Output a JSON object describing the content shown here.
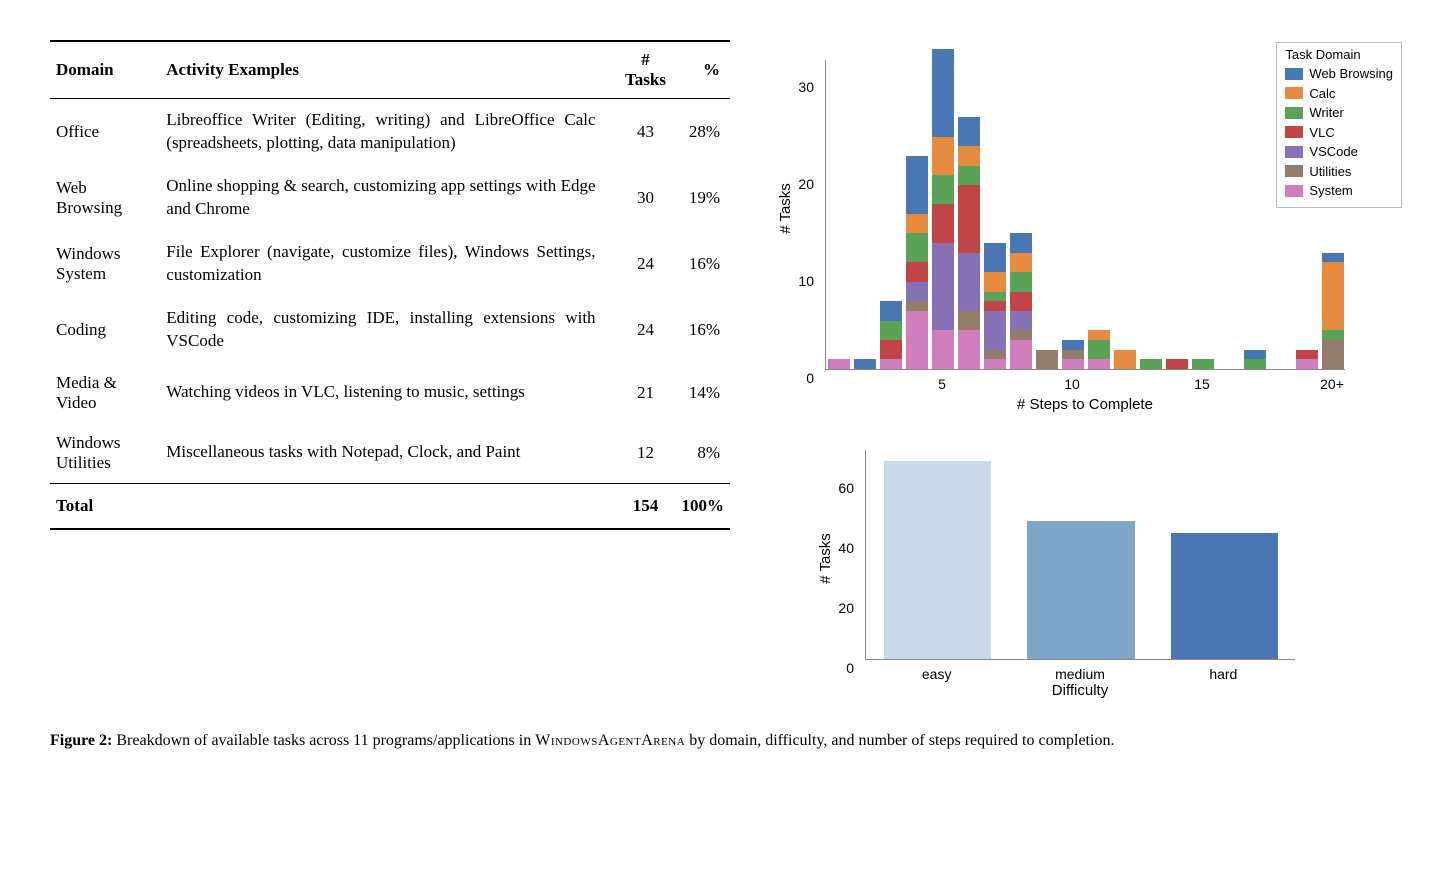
{
  "table": {
    "headers": [
      "Domain",
      "Activity Examples",
      "# Tasks",
      "%"
    ],
    "rows": [
      {
        "domain": "Office",
        "examples": "Libreoffice Writer (Editing, writing) and LibreOffice Calc (spreadsheets, plotting, data manipulation)",
        "tasks": "43",
        "pct": "28%"
      },
      {
        "domain": "Web Browsing",
        "examples": "Online shopping & search, customizing app settings with Edge and Chrome",
        "tasks": "30",
        "pct": "19%"
      },
      {
        "domain": "Windows System",
        "examples": "File Explorer (navigate, customize files), Windows Settings, customization",
        "tasks": "24",
        "pct": "16%"
      },
      {
        "domain": "Coding",
        "examples": "Editing code, customizing IDE, installing extensions with VSCode",
        "tasks": "24",
        "pct": "16%"
      },
      {
        "domain": "Media & Video",
        "examples": "Watching videos in VLC, listening to music, settings",
        "tasks": "21",
        "pct": "14%"
      },
      {
        "domain": "Windows Utilities",
        "examples": "Miscellaneous tasks with Notepad, Clock, and Paint",
        "tasks": "12",
        "pct": "8%"
      }
    ],
    "total": {
      "domain": "Total",
      "examples": "",
      "tasks": "154",
      "pct": "100%"
    }
  },
  "caption": {
    "label": "Figure 2:",
    "text_pre": " Breakdown of available tasks across 11 programs/applications in ",
    "text_sc": "WindowsAgentArena",
    "text_post": " by domain, difficulty, and number of steps required to completion."
  },
  "chart_data": [
    {
      "type": "bar",
      "stacked": true,
      "title": "",
      "xlabel": "# Steps to Complete",
      "ylabel": "# Tasks",
      "ylim": [
        0,
        32
      ],
      "yticks": [
        0,
        10,
        20,
        30
      ],
      "xticks": [
        5,
        10,
        15,
        "20+"
      ],
      "legend_title": "Task Domain",
      "legend_position": "upper right",
      "categories": [
        1,
        2,
        3,
        4,
        5,
        6,
        7,
        8,
        9,
        10,
        11,
        12,
        13,
        14,
        15,
        16,
        17,
        18,
        19,
        "20+"
      ],
      "series": [
        {
          "name": "Web Browsing",
          "color": "#4877b3",
          "values": [
            0,
            1,
            2,
            6,
            9,
            3,
            3,
            2,
            0,
            1,
            0,
            0,
            0,
            0,
            0,
            0,
            1,
            0,
            0,
            1
          ]
        },
        {
          "name": "Calc",
          "color": "#e58a3f",
          "values": [
            0,
            0,
            0,
            2,
            4,
            2,
            2,
            2,
            0,
            0,
            1,
            2,
            0,
            0,
            0,
            0,
            0,
            0,
            0,
            7
          ]
        },
        {
          "name": "Writer",
          "color": "#5aa256",
          "values": [
            0,
            0,
            2,
            3,
            3,
            2,
            1,
            2,
            0,
            0,
            2,
            0,
            1,
            0,
            1,
            0,
            1,
            0,
            0,
            1
          ]
        },
        {
          "name": "VLC",
          "color": "#c14446",
          "values": [
            0,
            0,
            2,
            2,
            4,
            7,
            1,
            2,
            0,
            0,
            0,
            0,
            0,
            1,
            0,
            0,
            0,
            0,
            1,
            0
          ]
        },
        {
          "name": "VSCode",
          "color": "#8671b6",
          "values": [
            0,
            0,
            0,
            2,
            9,
            6,
            4,
            2,
            0,
            0,
            0,
            0,
            0,
            0,
            0,
            0,
            0,
            0,
            0,
            0
          ]
        },
        {
          "name": "Utilities",
          "color": "#937c6a",
          "values": [
            0,
            0,
            0,
            1,
            0,
            2,
            1,
            1,
            2,
            1,
            0,
            0,
            0,
            0,
            0,
            0,
            0,
            0,
            0,
            3
          ]
        },
        {
          "name": "System",
          "color": "#d07dbd",
          "values": [
            1,
            0,
            1,
            6,
            4,
            4,
            1,
            3,
            0,
            1,
            1,
            0,
            0,
            0,
            0,
            0,
            0,
            0,
            1,
            0
          ]
        }
      ]
    },
    {
      "type": "bar",
      "title": "",
      "xlabel": "Difficulty",
      "ylabel": "# Tasks",
      "ylim": [
        0,
        70
      ],
      "yticks": [
        0,
        20,
        40,
        60
      ],
      "categories": [
        "easy",
        "medium",
        "hard"
      ],
      "values": [
        66,
        46,
        42
      ],
      "colors": [
        "#c9d9e9",
        "#7ea6c9",
        "#4877b3"
      ]
    }
  ]
}
